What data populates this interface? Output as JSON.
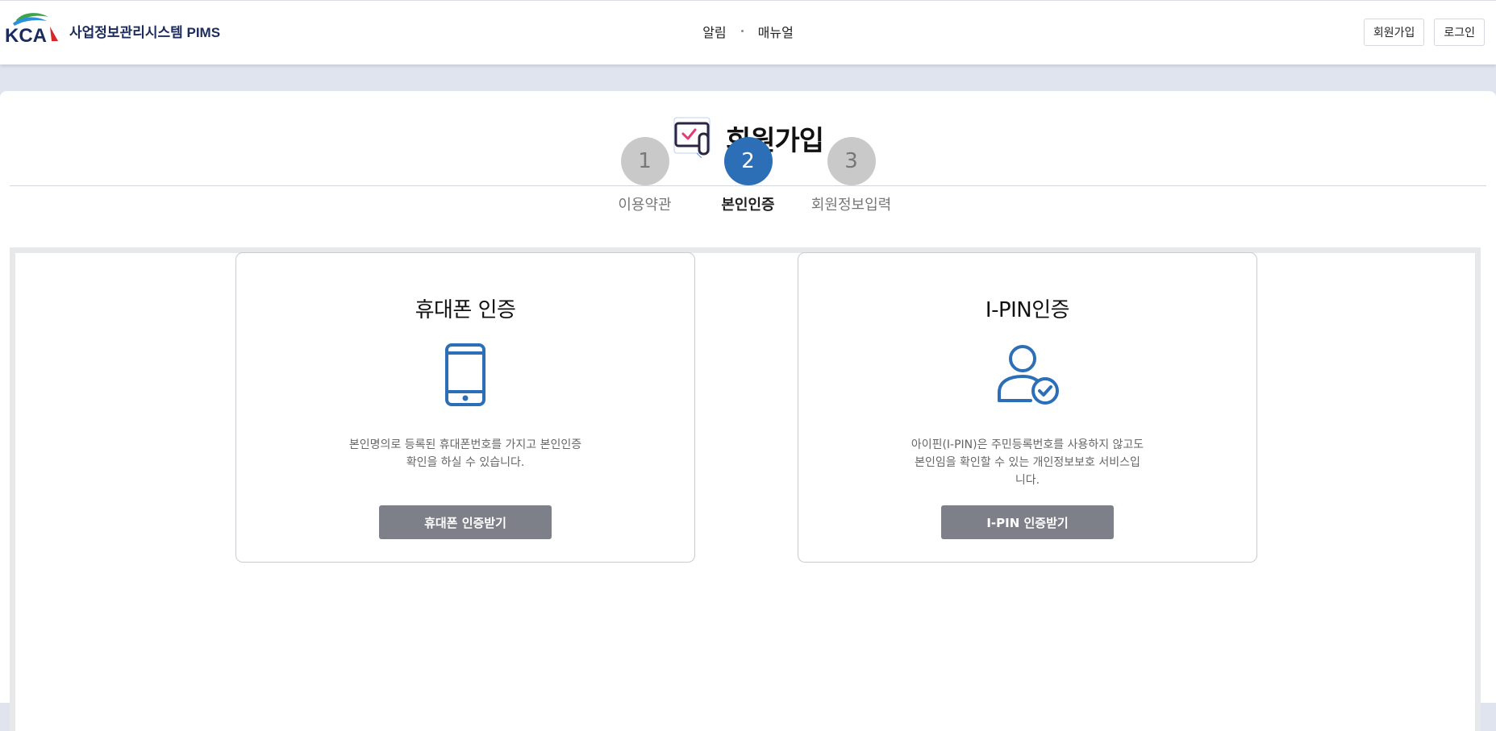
{
  "header": {
    "logo_mark": "KCA",
    "logo_text": "사업정보관리시스템 PIMS",
    "nav": [
      {
        "label": "알림"
      },
      {
        "label": "매뉴얼"
      }
    ],
    "actions": {
      "signup_label": "회원가입",
      "login_label": "로그인"
    }
  },
  "page": {
    "title": "회원가입"
  },
  "steps": [
    {
      "number": "1",
      "label": "이용약관",
      "active": false
    },
    {
      "number": "2",
      "label": "본인인증",
      "active": true
    },
    {
      "number": "3",
      "label": "회원정보입력",
      "active": false
    }
  ],
  "cards": {
    "phone": {
      "title": "휴대폰 인증",
      "icon": "smartphone-icon",
      "description": "본인명의로 등록된 휴대폰번호를 가지고 본인인증 확인을 하실 수 있습니다.",
      "button_label": "휴대폰 인증받기"
    },
    "ipin": {
      "title": "I-PIN인증",
      "icon": "user-check-icon",
      "description": "아이핀(I-PIN)은 주민등록번호를 사용하지 않고도 본인임을 확인할 수 있는 개인정보보호 서비스입니다.",
      "button_label": "I-PIN 인증받기"
    }
  },
  "colors": {
    "primary": "#2d6fb7",
    "step_inactive": "#c9c9c9",
    "button": "#7e8089",
    "brand_navy": "#1c2b5e",
    "brand_red": "#d62828",
    "brand_green": "#3aa64a",
    "brand_blue": "#2f8fd8"
  }
}
